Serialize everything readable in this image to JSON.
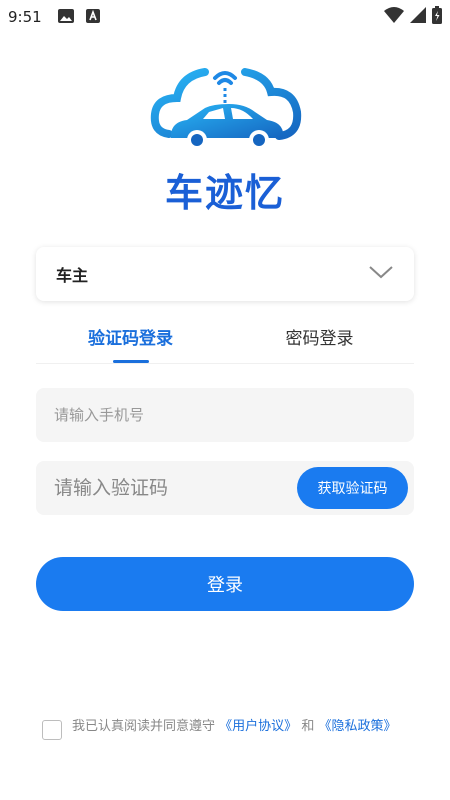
{
  "status_bar": {
    "time": "9:51",
    "left_icons": [
      "image-icon",
      "font-icon"
    ],
    "right_icons": [
      "wifi-icon",
      "signal-icon",
      "battery-icon"
    ]
  },
  "app": {
    "name": "车迹忆",
    "brand_color": "#1a5fd6",
    "accent_color": "#1a7bf0"
  },
  "role_select": {
    "value": "车主",
    "icon": "chevron-down-icon"
  },
  "tabs": [
    {
      "label": "验证码登录",
      "active": true
    },
    {
      "label": "密码登录",
      "active": false
    }
  ],
  "form": {
    "phone_placeholder": "请输入手机号",
    "code_placeholder": "请输入验证码",
    "get_code_label": "获取验证码"
  },
  "login_button": "登录",
  "agreement": {
    "prefix": "我已认真阅读并同意遵守",
    "user_agreement": "《用户协议》",
    "conjunction": "和",
    "privacy_policy": "《隐私政策》",
    "checked": false
  }
}
